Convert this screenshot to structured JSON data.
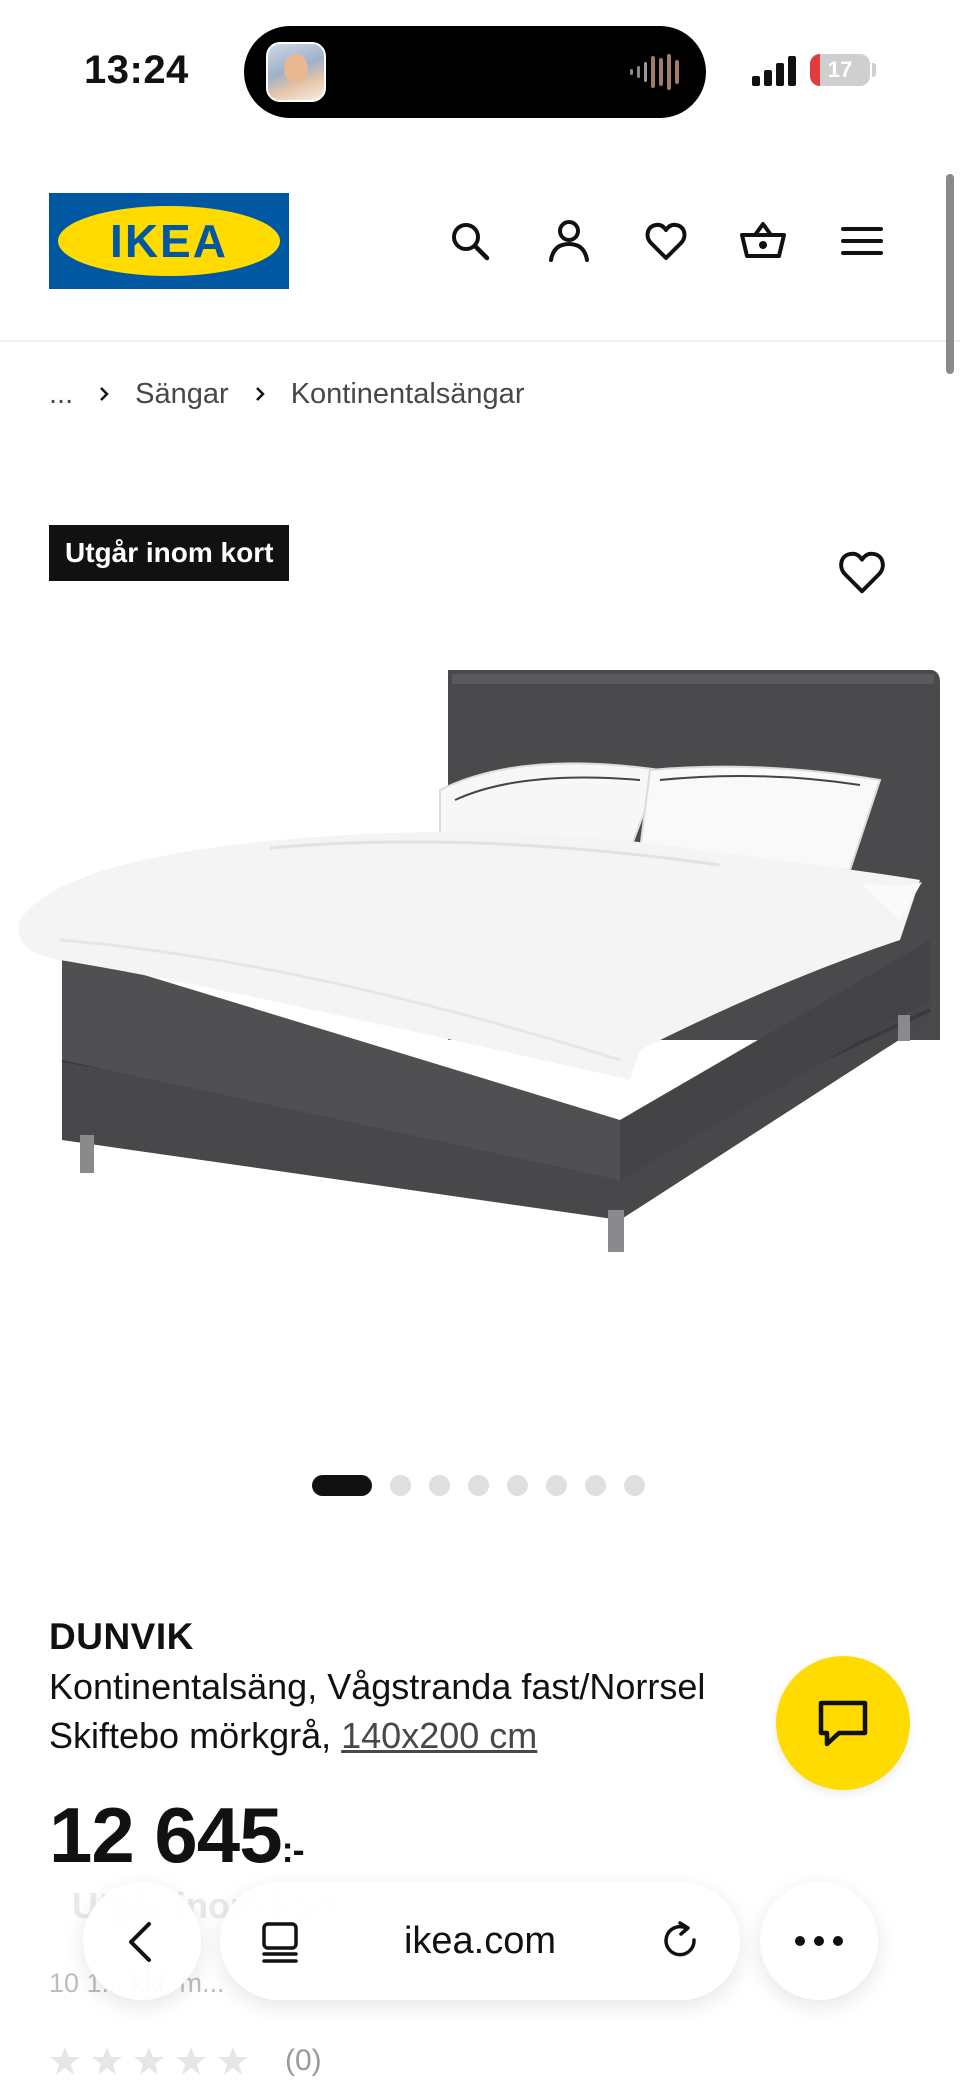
{
  "status_bar": {
    "time": "13:24",
    "battery_level": "17",
    "battery_fraction": 0.17,
    "icons": [
      "signal-icon",
      "battery-icon",
      "audio-waveform-icon"
    ]
  },
  "header": {
    "logo_text": "IKEA",
    "brand_colors": {
      "blue": "#0058a3",
      "yellow": "#ffdb00"
    },
    "icons": [
      "search-icon",
      "user-icon",
      "heart-icon",
      "basket-icon",
      "menu-icon"
    ]
  },
  "breadcrumb": {
    "items": [
      "...",
      "Sängar",
      "Kontinentalsängar"
    ]
  },
  "product": {
    "badge": "Utgår inom kort",
    "name": "DUNVIK",
    "description": "Kontinentalsäng, Vågstranda fast/Norrsel",
    "description_line2": "Skiftebo mörkgrå,",
    "size": "140x200 cm",
    "price": "12 645",
    "price_suffix": ":-",
    "stock_text": "Utgår inom kort",
    "unit_price_text": "10 1... kkl. m...",
    "rating_count": "(0)",
    "rating_value": 0,
    "carousel_total": 8,
    "carousel_active": 1
  },
  "browser": {
    "url": "ikea.com",
    "icons": [
      "back-icon",
      "tabs-icon",
      "reload-icon",
      "more-icon"
    ]
  }
}
